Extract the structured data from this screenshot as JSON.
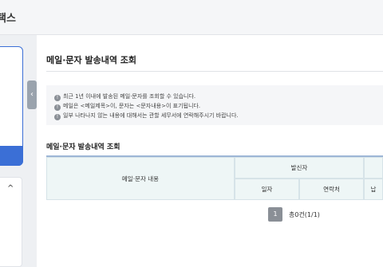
{
  "header": {
    "title": "택스"
  },
  "sidebar": {
    "toggle_icon": "chevron-left-icon",
    "list_chevron_icon": "chevron-up-icon"
  },
  "main": {
    "title": "메일·문자 발송내역 조회",
    "notices": [
      "최근 1년 이내에 발송된 메일·문자를 조회할 수 있습니다.",
      "메일은 <메일제목>이, 문자는 <문자내용>이 표기됩니다.",
      "일부 나타나지 않는 내용에 대해서는 관할 세무서에 연락해주시기 바랍니다."
    ],
    "section_title": "메일·문자 발송내역 조회",
    "table": {
      "col_content": "메일·문자 내용",
      "col_sender": "발신자",
      "col_date": "일자",
      "col_contact": "연락처",
      "col_next": "납"
    },
    "pager": {
      "current_page": "1",
      "summary": "총0건(1/1)"
    }
  }
}
